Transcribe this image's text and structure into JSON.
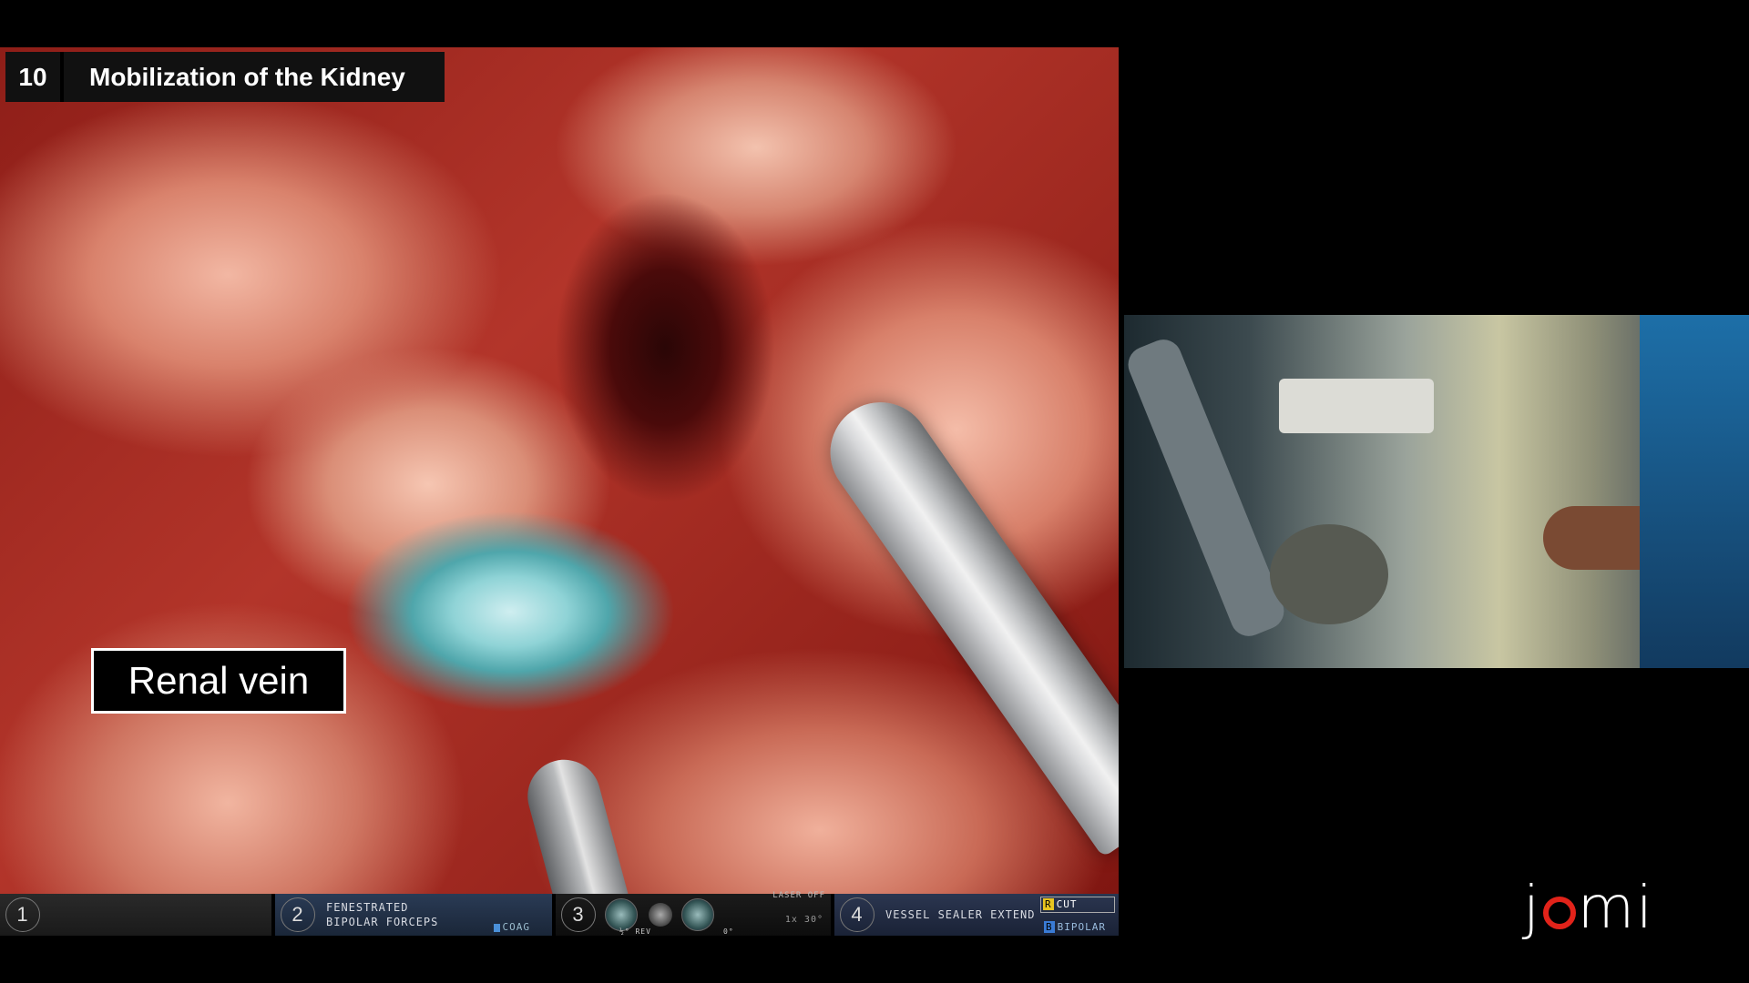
{
  "step": {
    "number": "10",
    "title": "Mobilization of the Kidney"
  },
  "annotation": {
    "label": "Renal vein"
  },
  "status_bar": {
    "arm1": {
      "number": "1"
    },
    "arm2": {
      "number": "2",
      "name_line1": "FENESTRATED",
      "name_line2": "BIPOLAR FORCEPS",
      "mode": "COAG"
    },
    "arm3": {
      "number": "3",
      "laser": "LASER OFF",
      "zoom": "1x 30°",
      "cam_label": "½° REV",
      "cam_label2": "0°"
    },
    "arm4": {
      "number": "4",
      "name": "VESSEL SEALER EXTEND",
      "cut": "CUT",
      "bipolar": "BIPOLAR",
      "cut_key": "R",
      "bipolar_key": "B"
    }
  },
  "logo": {
    "prefix": "j",
    "suffix": "mi"
  },
  "colors": {
    "logo_accent": "#e2231a",
    "title_bg": "#111111",
    "label_border": "#ffffff"
  }
}
